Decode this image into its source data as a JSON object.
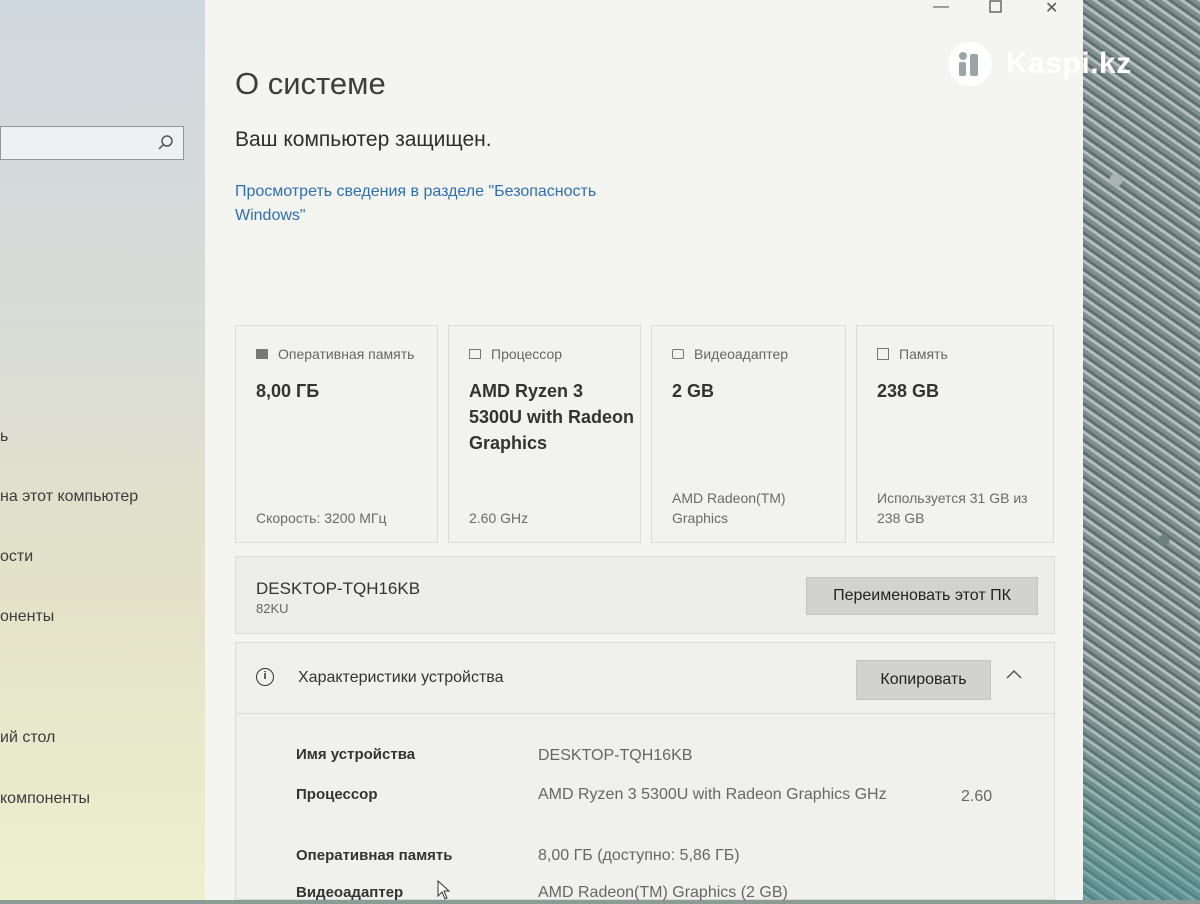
{
  "sidebar": {
    "items": [
      {
        "label": "ь"
      },
      {
        "label": "на этот компьютер"
      },
      {
        "label": "ости"
      },
      {
        "label": "оненты"
      },
      {
        "label": "ий стол"
      },
      {
        "label": "компоненты"
      }
    ]
  },
  "window": {
    "title": "О системе",
    "protected_text": "Ваш компьютер защищен.",
    "security_link": "Просмотреть сведения в разделе \"Безопасность Windows\""
  },
  "cards": [
    {
      "header": "Оперативная память",
      "value": "8,00 ГБ",
      "footer": "Скорость: 3200 МГц",
      "icon": "memory-icon"
    },
    {
      "header": "Процессор",
      "value": "AMD Ryzen 3 5300U with Radeon Graphics",
      "footer": "2.60 GHz",
      "icon": "cpu-icon"
    },
    {
      "header": "Видеоадаптер",
      "value": "2 GB",
      "footer": "AMD Radeon(TM) Graphics",
      "icon": "gpu-icon"
    },
    {
      "header": "Память",
      "value": "238 GB",
      "footer": "Используется 31 GB из 238 GB",
      "icon": "storage-icon"
    }
  ],
  "pc": {
    "name": "DESKTOP-TQH16KB",
    "model": "82KU",
    "rename_button": "Переименовать этот ПК"
  },
  "specs": {
    "title": "Характеристики устройства",
    "copy_button": "Копировать",
    "rows": [
      {
        "label": "Имя устройства",
        "value": "DESKTOP-TQH16KB",
        "extra": ""
      },
      {
        "label": "Процессор",
        "value": "AMD Ryzen 3 5300U with Radeon Graphics GHz",
        "extra": "2.60"
      },
      {
        "label": "Оперативная память",
        "value": "8,00 ГБ (доступно: 5,86 ГБ)",
        "extra": ""
      },
      {
        "label": "Видеоадаптер",
        "value": "AMD Radeon(TM) Graphics (2 GB)",
        "extra": ""
      }
    ]
  },
  "watermark": {
    "text": "Kaspi.kz"
  }
}
